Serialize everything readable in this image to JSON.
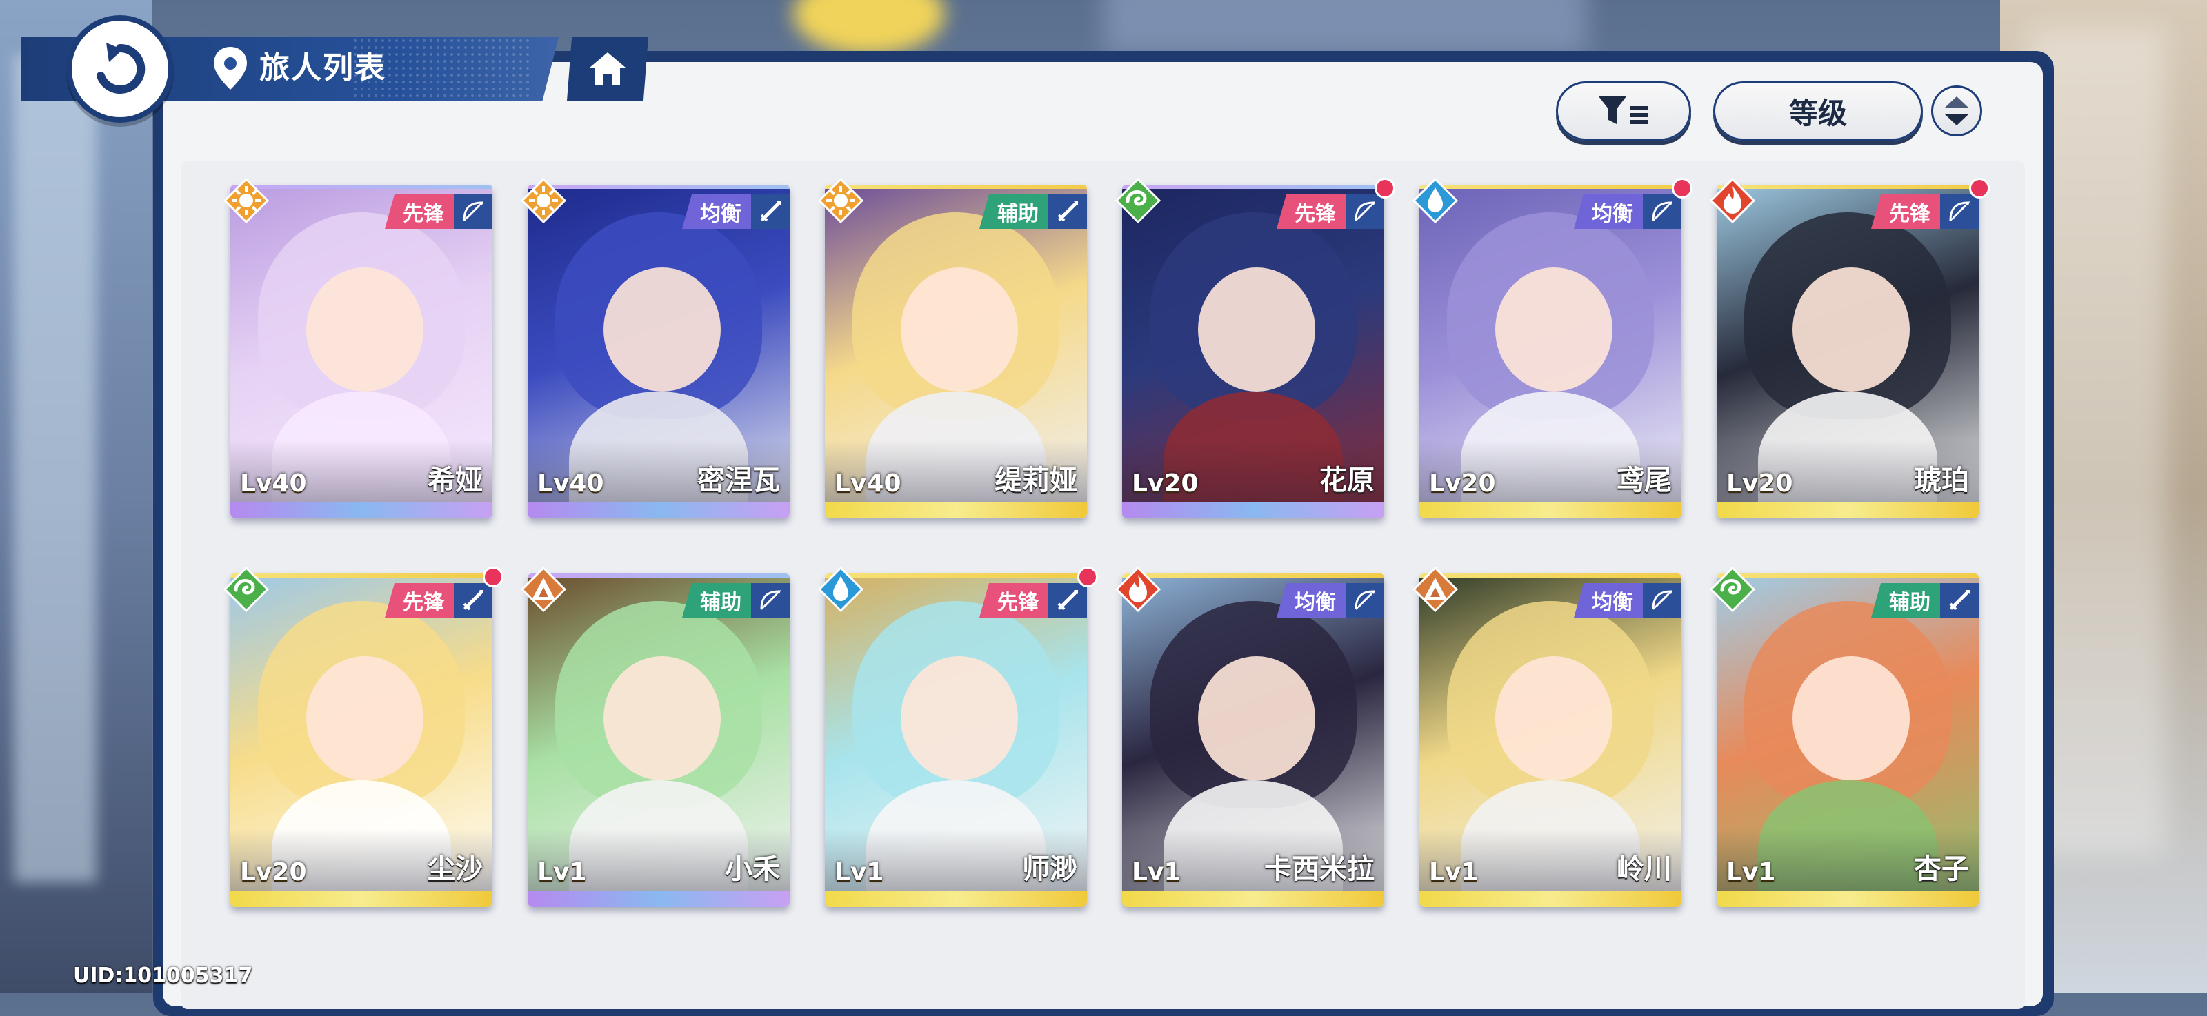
{
  "header": {
    "title": "旅人列表",
    "sort_label": "等级"
  },
  "uid": "UID:101005317",
  "colors": {
    "navy": "#1d3d78",
    "role_vanguard": "#e8517a",
    "role_balance": "#6f64d8",
    "role_support": "#2ea37a",
    "red_dot": "#e8335a"
  },
  "cards": [
    {
      "level": "Lv40",
      "name": "希娅",
      "role": "先锋",
      "element": "sun-icon",
      "weapon": "bow-icon",
      "dot": false,
      "frame": "purple",
      "palette": [
        "#e6d2f4",
        "#b99be0",
        "#f7e9ff"
      ]
    },
    {
      "level": "Lv40",
      "name": "密涅瓦",
      "role": "均衡",
      "element": "sun-icon",
      "weapon": "sword-icon",
      "dot": false,
      "frame": "purple",
      "palette": [
        "#3c4cbf",
        "#1d2a8c",
        "#e8e8f0"
      ]
    },
    {
      "level": "Lv40",
      "name": "缇莉娅",
      "role": "辅助",
      "element": "sun-icon",
      "weapon": "sword-icon",
      "dot": false,
      "frame": "gold",
      "palette": [
        "#f5d98a",
        "#6b4c9a",
        "#f0f0f5"
      ]
    },
    {
      "level": "Lv20",
      "name": "花原",
      "role": "先锋",
      "element": "wind-icon",
      "weapon": "bow-icon",
      "dot": true,
      "frame": "purple",
      "palette": [
        "#2b3a7c",
        "#1c2660",
        "#8c2b36"
      ]
    },
    {
      "level": "Lv20",
      "name": "鸢尾",
      "role": "均衡",
      "element": "water-icon",
      "weapon": "bow-icon",
      "dot": true,
      "frame": "gold",
      "palette": [
        "#9b90d8",
        "#6c63b8",
        "#f2f2f8"
      ]
    },
    {
      "level": "Lv20",
      "name": "琥珀",
      "role": "先锋",
      "element": "fire-icon",
      "weapon": "bow-icon",
      "dot": true,
      "frame": "gold",
      "palette": [
        "#262a3a",
        "#9dc8e0",
        "#f4f4f4"
      ]
    },
    {
      "level": "Lv20",
      "name": "尘沙",
      "role": "先锋",
      "element": "wind-icon",
      "weapon": "sword-icon",
      "dot": true,
      "frame": "gold",
      "palette": [
        "#f7dc8a",
        "#9cc8e8",
        "#ffffff"
      ]
    },
    {
      "level": "Lv1",
      "name": "小禾",
      "role": "辅助",
      "element": "earth-icon",
      "weapon": "bow-icon",
      "dot": false,
      "frame": "purple",
      "palette": [
        "#a8e0a4",
        "#6a4a2a",
        "#f4f4f4"
      ]
    },
    {
      "level": "Lv1",
      "name": "师渺",
      "role": "先锋",
      "element": "water-icon",
      "weapon": "sword-icon",
      "dot": true,
      "frame": "gold",
      "palette": [
        "#a8e4ec",
        "#d6b060",
        "#f6f6f6"
      ]
    },
    {
      "level": "Lv1",
      "name": "卡西米拉",
      "role": "均衡",
      "element": "fire-icon",
      "weapon": "bow-icon",
      "dot": false,
      "frame": "gold",
      "palette": [
        "#2a2640",
        "#8fb4d8",
        "#f4f4f4"
      ]
    },
    {
      "level": "Lv1",
      "name": "岭川",
      "role": "均衡",
      "element": "earth-icon",
      "weapon": "bow-icon",
      "dot": false,
      "frame": "gold",
      "palette": [
        "#f0d888",
        "#2e3a28",
        "#f2f2f2"
      ]
    },
    {
      "level": "Lv1",
      "name": "杏子",
      "role": "辅助",
      "element": "wind-icon",
      "weapon": "sword-icon",
      "dot": false,
      "frame": "gold",
      "palette": [
        "#e88a5a",
        "#9fcde8",
        "#8ec070"
      ]
    }
  ]
}
